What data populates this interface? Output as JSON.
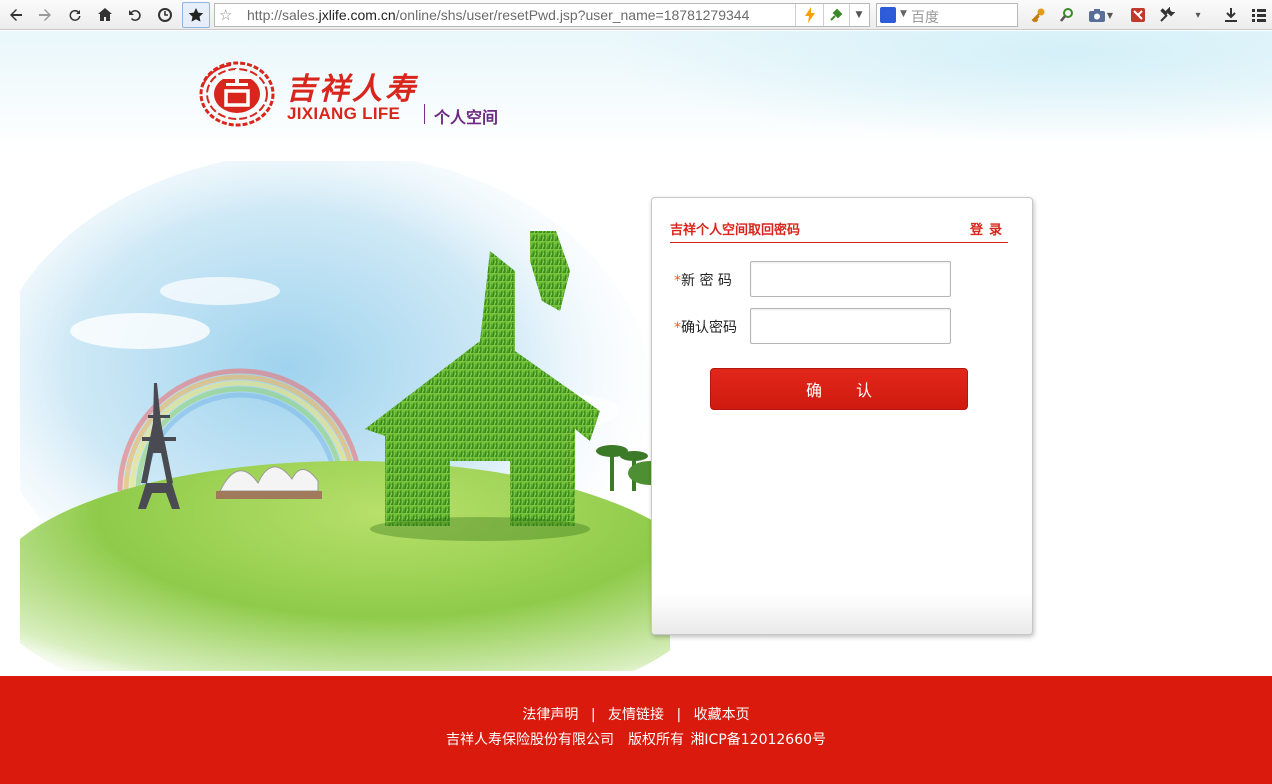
{
  "browser": {
    "address_url_prefix": "http://sales.",
    "address_url_domain": "jxlife.com.cn",
    "address_url_suffix": "/online/shs/user/resetPwd.jsp?user_name=18781279344",
    "search_placeholder": "百度",
    "search_engine_icon": "baidu-paw-icon"
  },
  "logo": {
    "name_cn": "吉祥人寿",
    "name_en": "JIXIANG LIFE",
    "subtitle": "个人空间"
  },
  "panel": {
    "title": "吉祥个人空间取回密码",
    "login_link": "登录",
    "new_password_label": "新 密 码",
    "confirm_password_label": "确认密码",
    "required_mark": "*",
    "new_password_value": "",
    "confirm_password_value": "",
    "submit_label": "确认"
  },
  "footer": {
    "links": [
      "法律声明",
      "友情链接",
      "收藏本页"
    ],
    "separator": "|",
    "copyright": "吉祥人寿保险股份有限公司　版权所有 湘ICP备12012660号"
  },
  "colors": {
    "brand_red": "#d9261c",
    "footer_red": "#d91a0c",
    "subtitle_purple": "#6b2a82"
  }
}
